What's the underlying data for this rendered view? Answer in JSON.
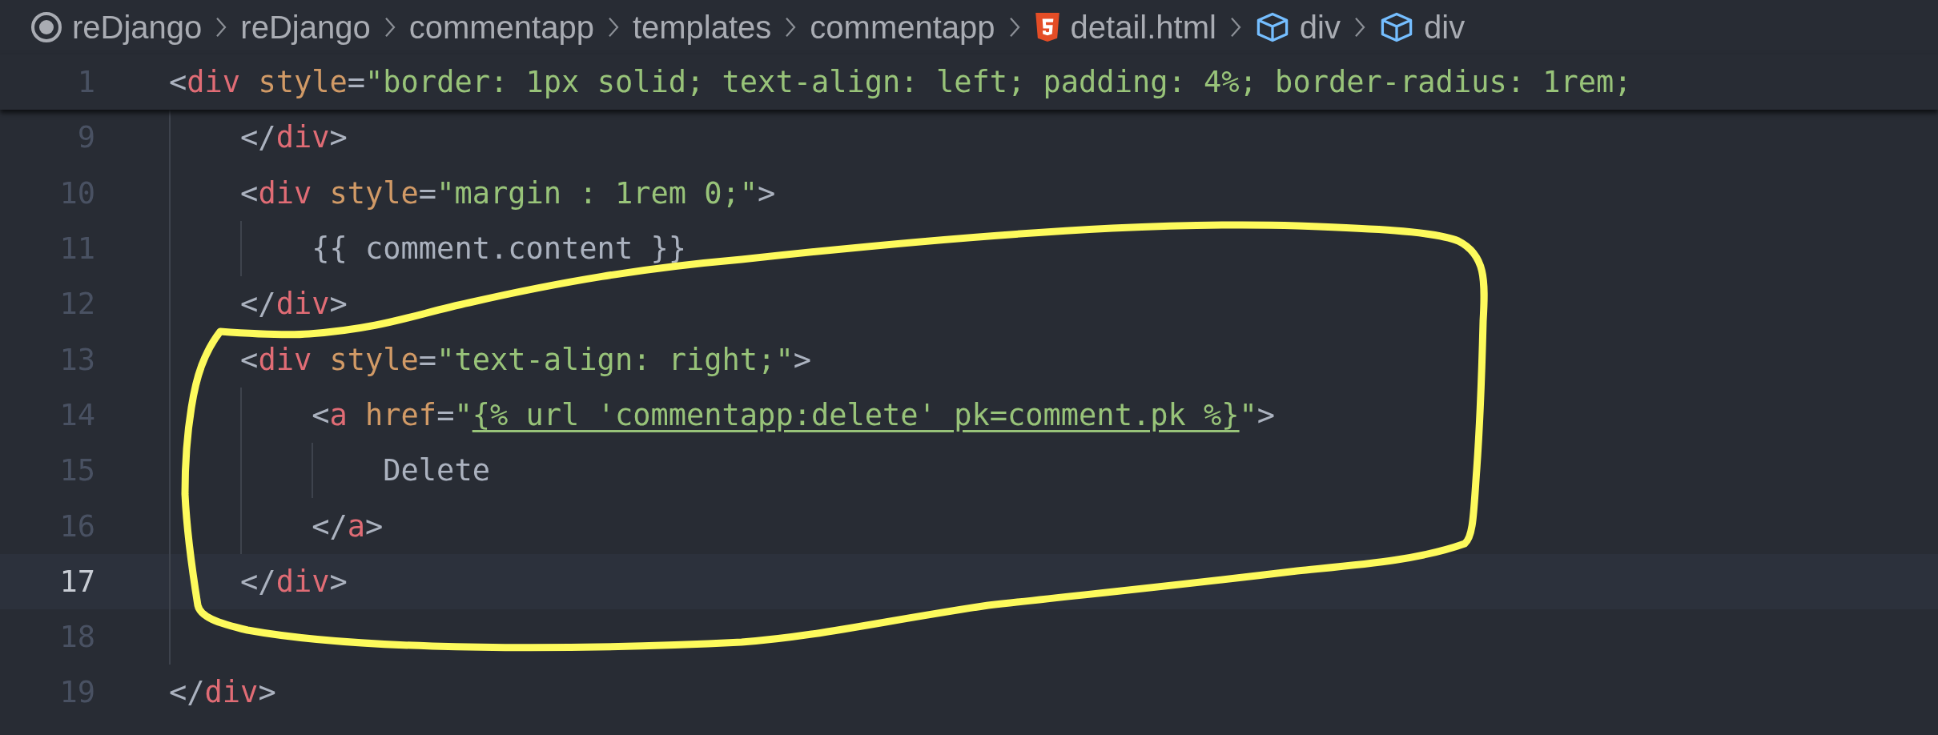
{
  "breadcrumb": [
    {
      "kind": "root",
      "label": "reDjango"
    },
    {
      "kind": "folder",
      "label": "reDjango"
    },
    {
      "kind": "folder",
      "label": "commentapp"
    },
    {
      "kind": "folder",
      "label": "templates"
    },
    {
      "kind": "folder",
      "label": "commentapp"
    },
    {
      "kind": "html",
      "label": "detail.html"
    },
    {
      "kind": "element",
      "label": "div"
    },
    {
      "kind": "element",
      "label": "div"
    }
  ],
  "editor": {
    "sticky_line": {
      "number": "1",
      "current": false,
      "tokens": [
        {
          "kind": "punct",
          "text": "<"
        },
        {
          "kind": "tag",
          "text": "div"
        },
        {
          "kind": "attr",
          "text": " style"
        },
        {
          "kind": "punct",
          "text": "="
        },
        {
          "kind": "string",
          "text": "\"border: 1px solid; text-align: left; padding: 4%; border-radius: 1rem;"
        }
      ],
      "children": [
        {
          "number": "9",
          "current": false,
          "tokens": [
            {
              "kind": "punct",
              "text": "</"
            },
            {
              "kind": "tag",
              "text": "div"
            },
            {
              "kind": "punct",
              "text": ">"
            }
          ]
        },
        {
          "number": "10",
          "current": false,
          "tokens": [
            {
              "kind": "punct",
              "text": "<"
            },
            {
              "kind": "tag",
              "text": "div"
            },
            {
              "kind": "attr",
              "text": " style"
            },
            {
              "kind": "punct",
              "text": "="
            },
            {
              "kind": "string",
              "text": "\"margin : 1rem 0;\""
            },
            {
              "kind": "punct",
              "text": ">"
            }
          ],
          "children": [
            {
              "number": "11",
              "current": false,
              "tokens": [
                {
                  "kind": "text",
                  "text": "{{ comment.content }}"
                }
              ]
            }
          ]
        },
        {
          "number": "12",
          "current": false,
          "tokens": [
            {
              "kind": "punct",
              "text": "</"
            },
            {
              "kind": "tag",
              "text": "div"
            },
            {
              "kind": "punct",
              "text": ">"
            }
          ]
        },
        {
          "number": "13",
          "current": false,
          "tokens": [
            {
              "kind": "punct",
              "text": "<"
            },
            {
              "kind": "tag",
              "text": "div"
            },
            {
              "kind": "attr",
              "text": " style"
            },
            {
              "kind": "punct",
              "text": "="
            },
            {
              "kind": "string",
              "text": "\"text-align: right;\""
            },
            {
              "kind": "punct",
              "text": ">"
            }
          ],
          "children": [
            {
              "number": "14",
              "current": false,
              "tokens": [
                {
                  "kind": "punct",
                  "text": "<"
                },
                {
                  "kind": "tag",
                  "text": "a"
                },
                {
                  "kind": "attr",
                  "text": " href"
                },
                {
                  "kind": "punct",
                  "text": "="
                },
                {
                  "kind": "string",
                  "text": "\""
                },
                {
                  "kind": "link",
                  "text": "{% url 'commentapp:delete' pk=comment.pk %}"
                },
                {
                  "kind": "string",
                  "text": "\""
                },
                {
                  "kind": "punct",
                  "text": ">"
                }
              ],
              "children": [
                {
                  "number": "15",
                  "current": false,
                  "tokens": [
                    {
                      "kind": "text",
                      "text": "Delete"
                    }
                  ]
                }
              ]
            },
            {
              "number": "16",
              "current": false,
              "tokens": [
                {
                  "kind": "punct",
                  "text": "</"
                },
                {
                  "kind": "tag",
                  "text": "a"
                },
                {
                  "kind": "punct",
                  "text": ">"
                }
              ]
            }
          ]
        },
        {
          "number": "17",
          "current": true,
          "tokens": [
            {
              "kind": "punct",
              "text": "</"
            },
            {
              "kind": "tag",
              "text": "div"
            },
            {
              "kind": "punct",
              "text": ">"
            }
          ]
        },
        {
          "number": "18",
          "current": false
        }
      ]
    },
    "lines": [
      {
        "number": "19",
        "current": false,
        "tokens": [
          {
            "kind": "punct",
            "text": "</"
          },
          {
            "kind": "tag",
            "text": "div"
          },
          {
            "kind": "punct",
            "text": ">"
          }
        ]
      }
    ]
  }
}
